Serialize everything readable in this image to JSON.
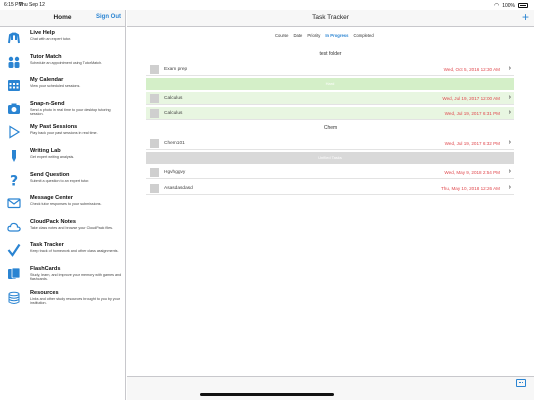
{
  "statusbar": {
    "time": "6:15 PM",
    "date": "Thu Sep 12",
    "battery": "100%"
  },
  "sidebar": {
    "title": "Home",
    "signout_label": "Sign Out",
    "items": [
      {
        "label": "Live Help",
        "desc": "Chat with an expert tutor.",
        "icon": "hands-icon",
        "color": "#2a84d2"
      },
      {
        "label": "Tutor Match",
        "desc": "Schedule an appointment using TutorMatch.",
        "icon": "people-icon",
        "color": "#2a84d2"
      },
      {
        "label": "My Calendar",
        "desc": "View your scheduled sessions.",
        "icon": "calendar-icon",
        "color": "#2a84d2"
      },
      {
        "label": "Snap-n-Send",
        "desc": "Send a photo in real time to your desktop tutoring session.",
        "icon": "camera-icon",
        "color": "#2a84d2"
      },
      {
        "label": "My Past Sessions",
        "desc": "Play back your past sessions in real time.",
        "icon": "play-icon",
        "color": "#2a84d2"
      },
      {
        "label": "Writing Lab",
        "desc": "Get expert writing analysis.",
        "icon": "pen-icon",
        "color": "#2a84d2"
      },
      {
        "label": "Send Question",
        "desc": "Submit a question to an expert tutor.",
        "icon": "question-icon",
        "color": "#2a84d2"
      },
      {
        "label": "Message Center",
        "desc": "Check tutor responses to your submissions.",
        "icon": "envelope-icon",
        "color": "#2a84d2"
      },
      {
        "label": "CloudPack Notes",
        "desc": "Take class notes and browse your CloudPack files.",
        "icon": "cloud-icon",
        "color": "#2a84d2"
      },
      {
        "label": "Task Tracker",
        "desc": "Keep track of homework and other class assignments.",
        "icon": "checkmark-icon",
        "color": "#2a84d2"
      },
      {
        "label": "FlashCards",
        "desc": "Study, learn, and improve your memory with games and flashcards.",
        "icon": "flashcards-icon",
        "color": "#2a84d2"
      },
      {
        "label": "Resources",
        "desc": "Links and other study resources brought to you by your institution.",
        "icon": "database-icon",
        "color": "#2a84d2"
      }
    ]
  },
  "main": {
    "title": "Task Tracker",
    "sort_tabs": [
      "Course",
      "Date",
      "Priority",
      "In Progress",
      "Completed"
    ],
    "active_tab": "In Progress",
    "sections": [
      {
        "title": "test folder"
      },
      {
        "title": "Chem"
      }
    ],
    "rows": [
      {
        "name": "Exam prep",
        "date": "Wed, Oct 5, 2016 12:30 AM"
      },
      {
        "name": "Calculus",
        "date": "Wed, Jul 19, 2017 12:00 AM"
      },
      {
        "name": "Calculus",
        "date": "Wed, Jul 19, 2017 6:31 PM"
      },
      {
        "name": "Chem101",
        "date": "Wed, Jul 19, 2017 6:32 PM"
      },
      {
        "name": "Hgvhggvy",
        "date": "Wed, May 9, 2018 2:54 PM"
      },
      {
        "name": "Asasdasdasd",
        "date": "Thu, May 10, 2018 12:26 AM"
      }
    ],
    "band_labels": [
      "Hard",
      "Unfiled Tasks"
    ]
  },
  "colors": {
    "accent": "#2a84d2",
    "due": "#e0484d",
    "green_band": "#d4efc8",
    "gray_band": "#d9d9d9"
  }
}
